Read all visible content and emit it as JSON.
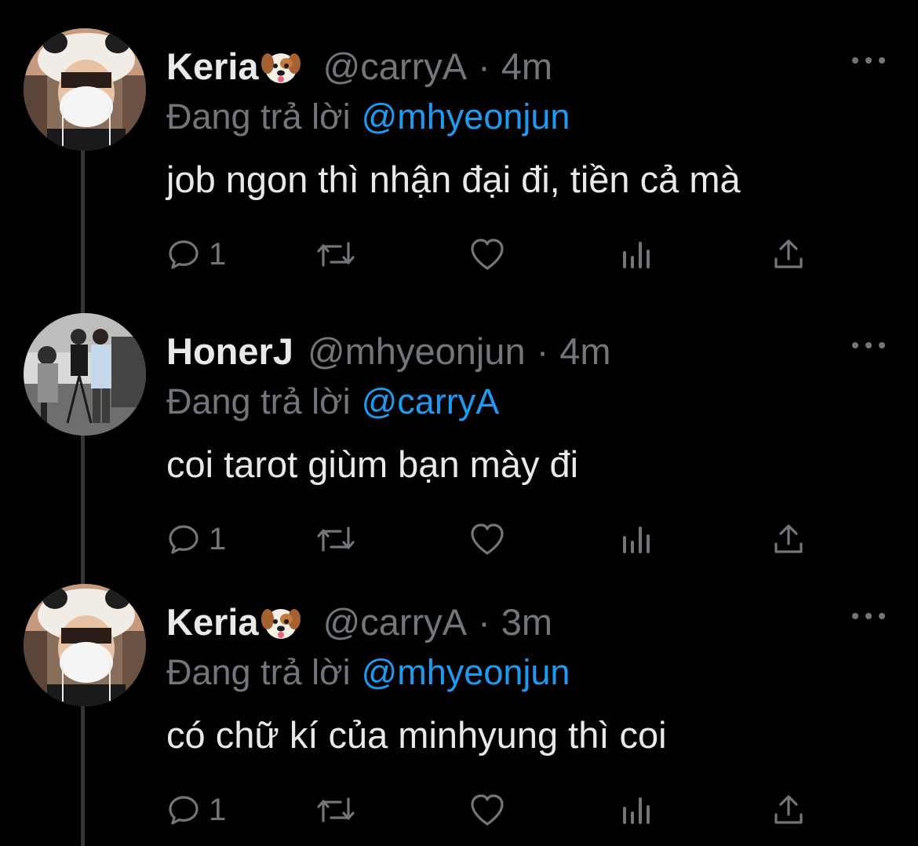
{
  "thread": {
    "tweets": [
      {
        "display_name": "Keria",
        "badge_icon": "dog-face-emoji",
        "handle": "@carryA",
        "separator": "·",
        "time": "4m",
        "replying_prefix": "Đang trả lời",
        "replying_to": "@mhyeonjun",
        "text": "job ngon thì nhận đại đi, tiền cả mà",
        "reply_count": "1"
      },
      {
        "display_name": "HonerJ",
        "handle": "@mhyeonjun",
        "separator": "·",
        "time": "4m",
        "replying_prefix": "Đang trả lời",
        "replying_to": "@carryA",
        "text": "coi tarot giùm bạn mày đi",
        "reply_count": "1"
      },
      {
        "display_name": "Keria",
        "badge_icon": "dog-face-emoji",
        "handle": "@carryA",
        "separator": "·",
        "time": "3m",
        "replying_prefix": "Đang trả lời",
        "replying_to": "@mhyeonjun",
        "text": "có chữ kí của minhyung thì coi",
        "reply_count": "1"
      }
    ]
  },
  "icons": {
    "reply": "speech-bubble-icon",
    "retweet": "retweet-icon",
    "like": "heart-icon",
    "views": "bar-chart-icon",
    "share": "share-upload-icon",
    "more": "more-options-icon"
  },
  "colors": {
    "background": "#000000",
    "primary_text": "#e7e9ea",
    "secondary_text": "#71767b",
    "mention": "#1d9bf0",
    "thread_line": "#333639"
  }
}
